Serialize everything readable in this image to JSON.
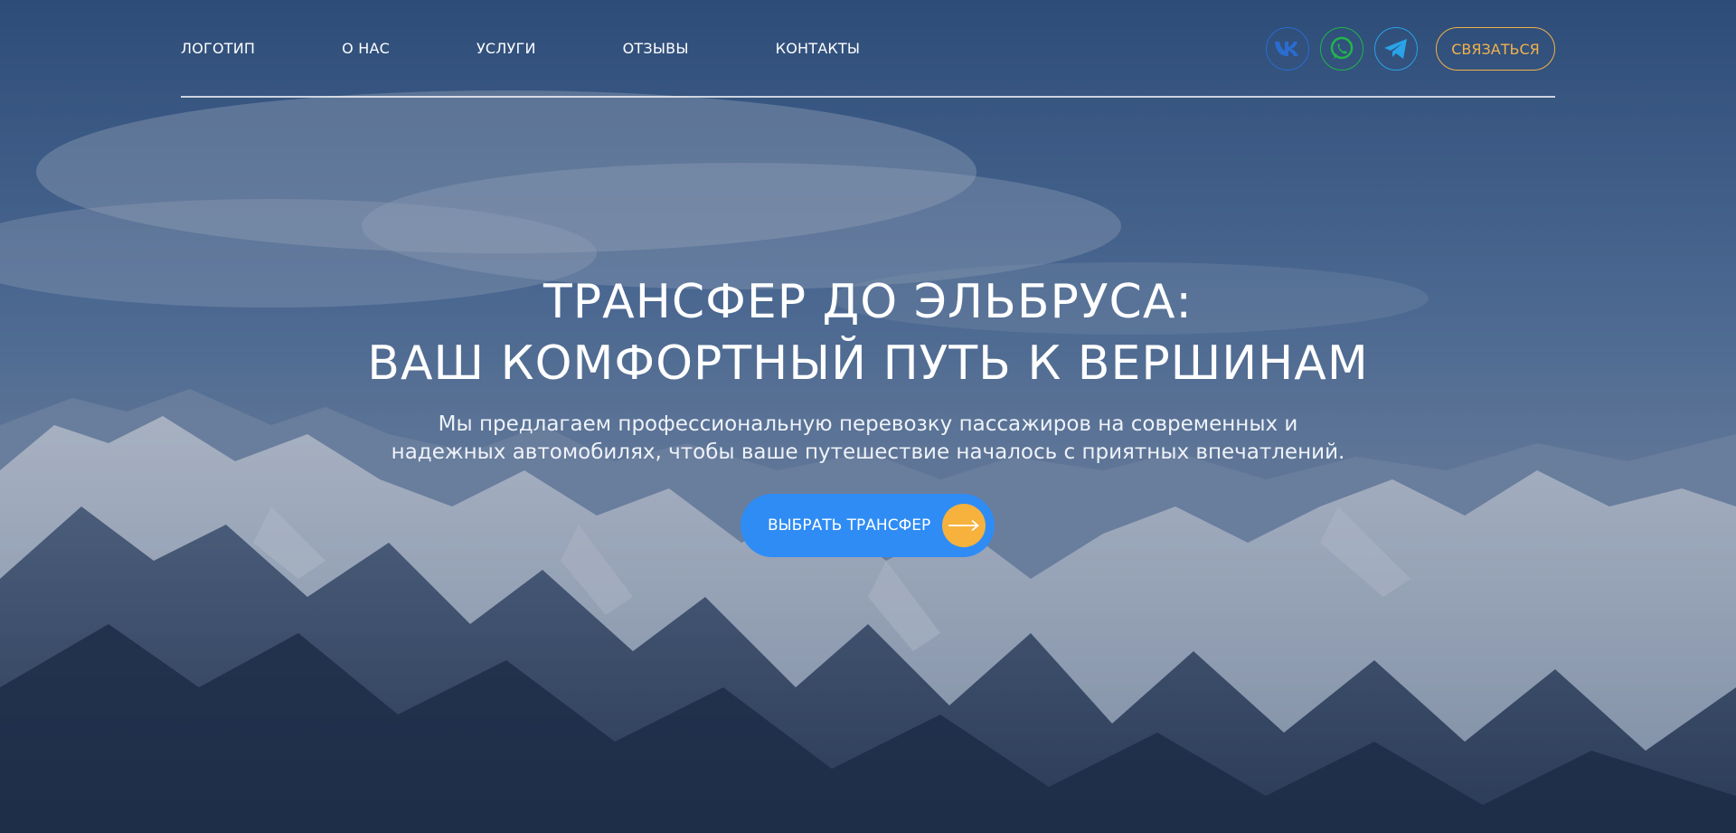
{
  "nav": {
    "logo": "ЛОГОТИП",
    "items": [
      {
        "label": "О НАС"
      },
      {
        "label": "УСЛУГИ"
      },
      {
        "label": "ОТЗЫВЫ"
      },
      {
        "label": "КОНТАКТЫ"
      }
    ]
  },
  "socials": [
    {
      "icon": "vk-icon",
      "color": "#2a6cd0"
    },
    {
      "icon": "whatsapp-icon",
      "color": "#22b54a"
    },
    {
      "icon": "telegram-icon",
      "color": "#2aa3e8"
    }
  ],
  "header": {
    "contact_label": "СВЯЗАТЬСЯ"
  },
  "hero": {
    "title_line1": "ТРАНСФЕР ДО ЭЛЬБРУСА:",
    "title_line2": "ВАШ КОМФОРТНЫЙ ПУТЬ К ВЕРШИНАМ",
    "subtitle_line1": "Мы предлагаем профессиональную перевозку пассажиров на современных и",
    "subtitle_line2": "надежных автомобилях, чтобы ваше путешествие началось с приятных впечатлений.",
    "cta_label": "ВЫБРАТЬ ТРАНСФЕР",
    "cta_icon": "arrow-right-icon"
  },
  "colors": {
    "accent_blue": "#2f8cf4",
    "accent_orange": "#f6b23d",
    "contact_border": "#f0b24a"
  }
}
